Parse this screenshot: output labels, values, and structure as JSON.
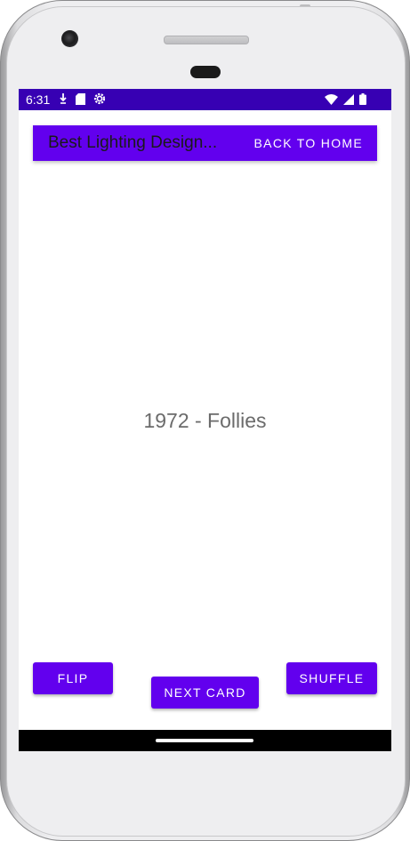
{
  "status_bar": {
    "time": "6:31",
    "left_icons": [
      "download-icon",
      "sd-card-icon",
      "settings-icon"
    ],
    "right_icons": [
      "wifi-icon",
      "cell-signal-icon",
      "battery-icon"
    ],
    "color": "#3700b3"
  },
  "app_bar": {
    "title": "Best Lighting Design...",
    "back_label": "BACK TO HOME",
    "color": "#6200ee"
  },
  "card": {
    "text": "1972 - Follies"
  },
  "buttons": {
    "flip": "FLIP",
    "next_card": "NEXT CARD",
    "shuffle": "SHUFFLE",
    "color": "#6200ee"
  }
}
